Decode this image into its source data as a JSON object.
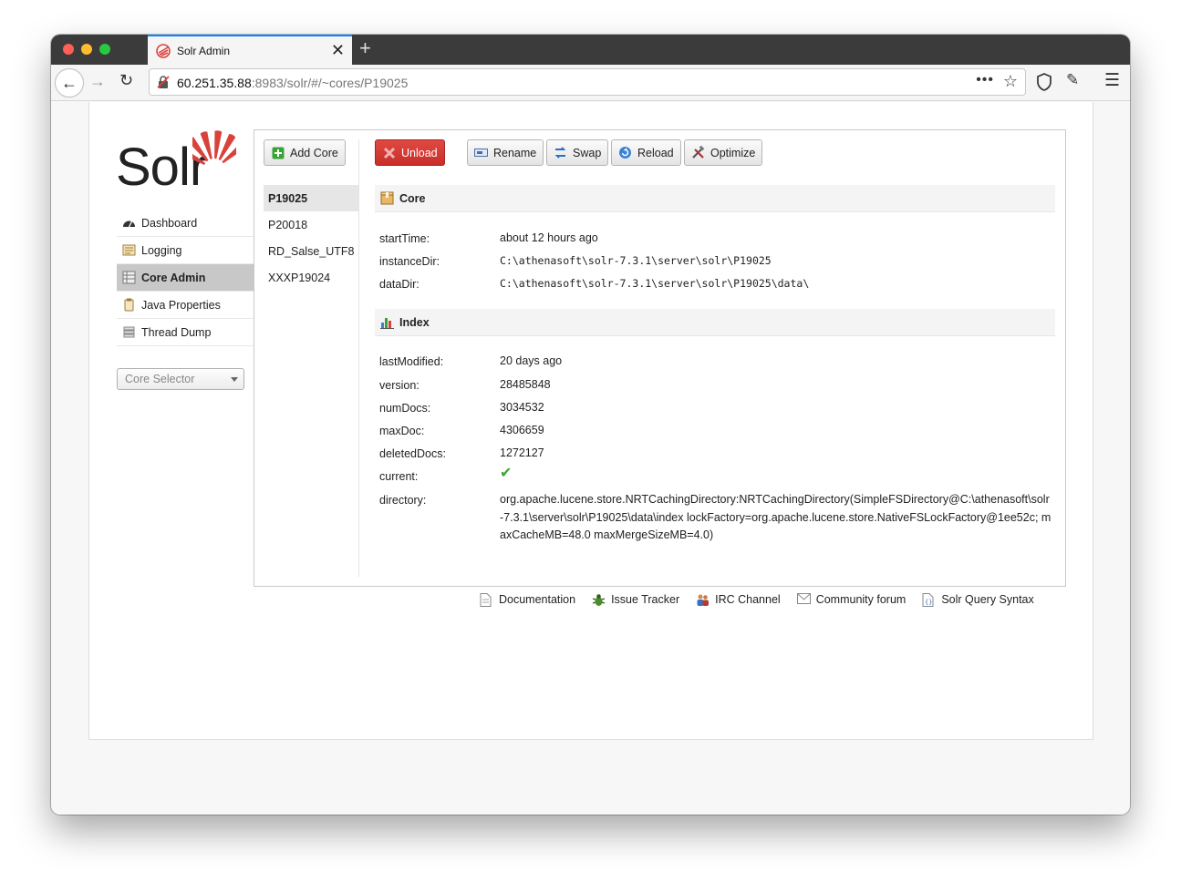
{
  "browser": {
    "tab_title": "Solr Admin",
    "url_host": "60.251.35.88",
    "url_rest": ":8983/solr/#/~cores/P19025",
    "close_glyph": "✕",
    "newtab_glyph": "+",
    "more_glyph": "•••"
  },
  "logo": {
    "text": "Solr"
  },
  "sidebar": {
    "items": [
      {
        "label": "Dashboard",
        "icon": "dashboard-icon"
      },
      {
        "label": "Logging",
        "icon": "logging-icon"
      },
      {
        "label": "Core Admin",
        "icon": "core-admin-icon",
        "active": true
      },
      {
        "label": "Java Properties",
        "icon": "java-icon"
      },
      {
        "label": "Thread Dump",
        "icon": "thread-dump-icon"
      }
    ],
    "core_selector": "Core Selector"
  },
  "actions": {
    "add_core": "Add Core",
    "unload": "Unload",
    "rename": "Rename",
    "swap": "Swap",
    "reload": "Reload",
    "optimize": "Optimize"
  },
  "cores": [
    "P19025",
    "P20018",
    "RD_Salse_UTF8",
    "XXXP19024"
  ],
  "core_section": {
    "title": "Core",
    "rows": [
      {
        "key": "startTime:",
        "value": "about 12 hours ago"
      },
      {
        "key": "instanceDir:",
        "value": "C:\\athenasoft\\solr-7.3.1\\server\\solr\\P19025"
      },
      {
        "key": "dataDir:",
        "value": "C:\\athenasoft\\solr-7.3.1\\server\\solr\\P19025\\data\\"
      }
    ]
  },
  "index_section": {
    "title": "Index",
    "rows": [
      {
        "key": "lastModified:",
        "value": "20 days ago"
      },
      {
        "key": "version:",
        "value": "28485848"
      },
      {
        "key": "numDocs:",
        "value": "3034532"
      },
      {
        "key": "maxDoc:",
        "value": "4306659"
      },
      {
        "key": "deletedDocs:",
        "value": "1272127"
      },
      {
        "key": "current:",
        "value": "✔"
      },
      {
        "key": "directory:",
        "value": "org.apache.lucene.store.NRTCachingDirectory:NRTCachingDirectory(SimpleFSDirectory@C:\\athenasoft\\solr-7.3.1\\server\\solr\\P19025\\data\\index lockFactory=org.apache.lucene.store.NativeFSLockFactory@1ee52c; maxCacheMB=48.0 maxMergeSizeMB=4.0)"
      }
    ]
  },
  "footer": {
    "links": [
      "Documentation",
      "Issue Tracker",
      "IRC Channel",
      "Community forum",
      "Solr Query Syntax"
    ]
  },
  "colors": {
    "accent_red": "#d9423b",
    "active_nav": "#c8c8c8",
    "check_green": "#3aa335"
  }
}
